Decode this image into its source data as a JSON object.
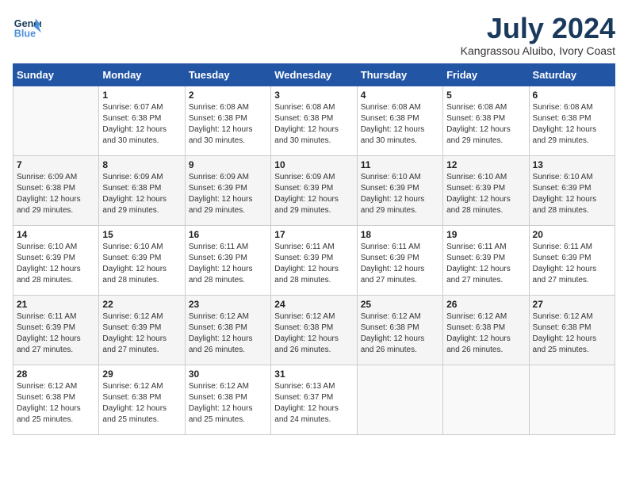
{
  "header": {
    "logo_line1": "General",
    "logo_line2": "Blue",
    "month_year": "July 2024",
    "location": "Kangrassou Aluibo, Ivory Coast"
  },
  "days_of_week": [
    "Sunday",
    "Monday",
    "Tuesday",
    "Wednesday",
    "Thursday",
    "Friday",
    "Saturday"
  ],
  "weeks": [
    [
      {
        "day": "",
        "info": ""
      },
      {
        "day": "1",
        "info": "Sunrise: 6:07 AM\nSunset: 6:38 PM\nDaylight: 12 hours\nand 30 minutes."
      },
      {
        "day": "2",
        "info": "Sunrise: 6:08 AM\nSunset: 6:38 PM\nDaylight: 12 hours\nand 30 minutes."
      },
      {
        "day": "3",
        "info": "Sunrise: 6:08 AM\nSunset: 6:38 PM\nDaylight: 12 hours\nand 30 minutes."
      },
      {
        "day": "4",
        "info": "Sunrise: 6:08 AM\nSunset: 6:38 PM\nDaylight: 12 hours\nand 30 minutes."
      },
      {
        "day": "5",
        "info": "Sunrise: 6:08 AM\nSunset: 6:38 PM\nDaylight: 12 hours\nand 29 minutes."
      },
      {
        "day": "6",
        "info": "Sunrise: 6:08 AM\nSunset: 6:38 PM\nDaylight: 12 hours\nand 29 minutes."
      }
    ],
    [
      {
        "day": "7",
        "info": "Sunrise: 6:09 AM\nSunset: 6:38 PM\nDaylight: 12 hours\nand 29 minutes."
      },
      {
        "day": "8",
        "info": "Sunrise: 6:09 AM\nSunset: 6:38 PM\nDaylight: 12 hours\nand 29 minutes."
      },
      {
        "day": "9",
        "info": "Sunrise: 6:09 AM\nSunset: 6:39 PM\nDaylight: 12 hours\nand 29 minutes."
      },
      {
        "day": "10",
        "info": "Sunrise: 6:09 AM\nSunset: 6:39 PM\nDaylight: 12 hours\nand 29 minutes."
      },
      {
        "day": "11",
        "info": "Sunrise: 6:10 AM\nSunset: 6:39 PM\nDaylight: 12 hours\nand 29 minutes."
      },
      {
        "day": "12",
        "info": "Sunrise: 6:10 AM\nSunset: 6:39 PM\nDaylight: 12 hours\nand 28 minutes."
      },
      {
        "day": "13",
        "info": "Sunrise: 6:10 AM\nSunset: 6:39 PM\nDaylight: 12 hours\nand 28 minutes."
      }
    ],
    [
      {
        "day": "14",
        "info": "Sunrise: 6:10 AM\nSunset: 6:39 PM\nDaylight: 12 hours\nand 28 minutes."
      },
      {
        "day": "15",
        "info": "Sunrise: 6:10 AM\nSunset: 6:39 PM\nDaylight: 12 hours\nand 28 minutes."
      },
      {
        "day": "16",
        "info": "Sunrise: 6:11 AM\nSunset: 6:39 PM\nDaylight: 12 hours\nand 28 minutes."
      },
      {
        "day": "17",
        "info": "Sunrise: 6:11 AM\nSunset: 6:39 PM\nDaylight: 12 hours\nand 28 minutes."
      },
      {
        "day": "18",
        "info": "Sunrise: 6:11 AM\nSunset: 6:39 PM\nDaylight: 12 hours\nand 27 minutes."
      },
      {
        "day": "19",
        "info": "Sunrise: 6:11 AM\nSunset: 6:39 PM\nDaylight: 12 hours\nand 27 minutes."
      },
      {
        "day": "20",
        "info": "Sunrise: 6:11 AM\nSunset: 6:39 PM\nDaylight: 12 hours\nand 27 minutes."
      }
    ],
    [
      {
        "day": "21",
        "info": "Sunrise: 6:11 AM\nSunset: 6:39 PM\nDaylight: 12 hours\nand 27 minutes."
      },
      {
        "day": "22",
        "info": "Sunrise: 6:12 AM\nSunset: 6:39 PM\nDaylight: 12 hours\nand 27 minutes."
      },
      {
        "day": "23",
        "info": "Sunrise: 6:12 AM\nSunset: 6:38 PM\nDaylight: 12 hours\nand 26 minutes."
      },
      {
        "day": "24",
        "info": "Sunrise: 6:12 AM\nSunset: 6:38 PM\nDaylight: 12 hours\nand 26 minutes."
      },
      {
        "day": "25",
        "info": "Sunrise: 6:12 AM\nSunset: 6:38 PM\nDaylight: 12 hours\nand 26 minutes."
      },
      {
        "day": "26",
        "info": "Sunrise: 6:12 AM\nSunset: 6:38 PM\nDaylight: 12 hours\nand 26 minutes."
      },
      {
        "day": "27",
        "info": "Sunrise: 6:12 AM\nSunset: 6:38 PM\nDaylight: 12 hours\nand 25 minutes."
      }
    ],
    [
      {
        "day": "28",
        "info": "Sunrise: 6:12 AM\nSunset: 6:38 PM\nDaylight: 12 hours\nand 25 minutes."
      },
      {
        "day": "29",
        "info": "Sunrise: 6:12 AM\nSunset: 6:38 PM\nDaylight: 12 hours\nand 25 minutes."
      },
      {
        "day": "30",
        "info": "Sunrise: 6:12 AM\nSunset: 6:38 PM\nDaylight: 12 hours\nand 25 minutes."
      },
      {
        "day": "31",
        "info": "Sunrise: 6:13 AM\nSunset: 6:37 PM\nDaylight: 12 hours\nand 24 minutes."
      },
      {
        "day": "",
        "info": ""
      },
      {
        "day": "",
        "info": ""
      },
      {
        "day": "",
        "info": ""
      }
    ]
  ]
}
